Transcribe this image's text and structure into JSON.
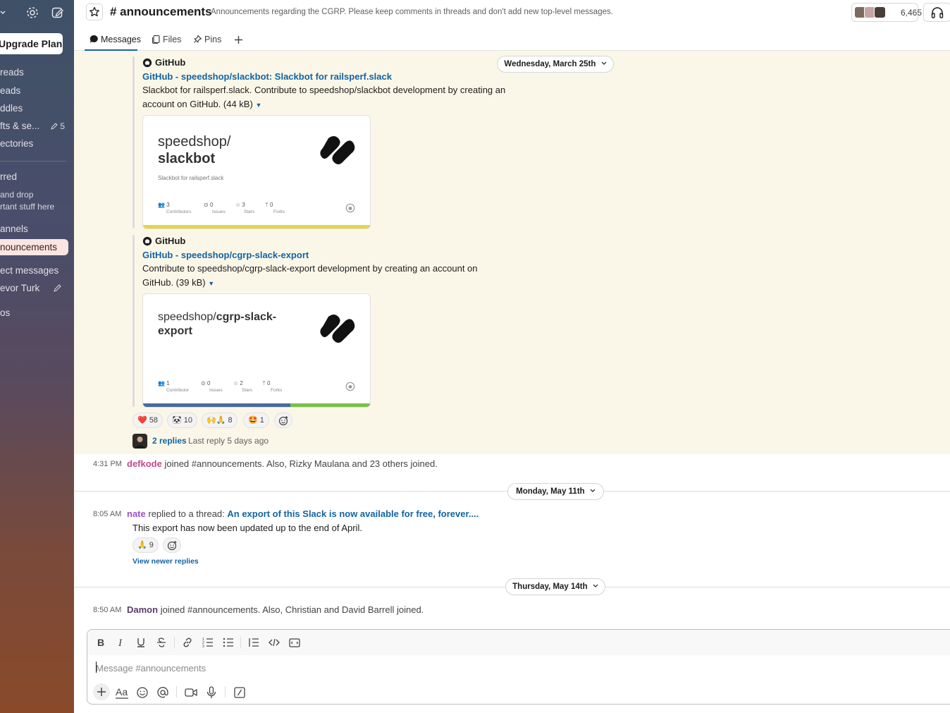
{
  "sidebar": {
    "upgrade_label": "Upgrade Plan",
    "items": [
      {
        "label": "Threads",
        "visible": "reads"
      },
      {
        "label": "Threads",
        "visible": "eads"
      },
      {
        "label": "Huddles",
        "visible": "ddles"
      },
      {
        "label": "Drafts & sent",
        "visible": "fts & se..."
      },
      {
        "label": "Directories",
        "visible": "ectories"
      }
    ],
    "drafts_count": "5",
    "starred_label": "rred",
    "starred_hint_1": "and drop",
    "starred_hint_2": "rtant stuff here",
    "channels_label": "annels",
    "active_channel": "nouncements",
    "dm_label": "ect messages",
    "dm_user": "evor Turk",
    "apps_label": "os"
  },
  "header": {
    "channel_name": "# announcements",
    "description": "Announcements regarding the CGRP. Please keep comments in threads and don't add new top-level messages.",
    "member_count": "6,465",
    "tabs": [
      {
        "label": "Messages",
        "icon": "message-icon"
      },
      {
        "label": "Files",
        "icon": "files-icon"
      },
      {
        "label": "Pins",
        "icon": "pin-icon"
      }
    ]
  },
  "feed": {
    "date_1": "Wednesday, March 25th",
    "attachments": [
      {
        "source": "GitHub",
        "title": "GitHub - speedshop/slackbot: Slackbot for railsperf.slack",
        "description": "Slackbot for railsperf.slack. Contribute to speedshop/slackbot development by creating an account on GitHub. (44 kB)",
        "card_title_1": "speedshop/",
        "card_title_2": "slackbot",
        "card_subtitle": "Slackbot for railsperf.slack",
        "stats": [
          {
            "value": "3",
            "label": "Contributors"
          },
          {
            "value": "0",
            "label": "Issues"
          },
          {
            "value": "3",
            "label": "Stars"
          },
          {
            "value": "0",
            "label": "Forks"
          }
        ]
      },
      {
        "source": "GitHub",
        "title": "GitHub - speedshop/cgrp-slack-export",
        "description": "Contribute to speedshop/cgrp-slack-export development by creating an account on GitHub. (39 kB)",
        "card_title_1": "speedshop/",
        "card_title_bold": "cgrp-slack-",
        "card_title_2": "export",
        "stats": [
          {
            "value": "1",
            "label": "Contributor"
          },
          {
            "value": "0",
            "label": "Issues"
          },
          {
            "value": "2",
            "label": "Stars"
          },
          {
            "value": "0",
            "label": "Forks"
          }
        ]
      }
    ],
    "reactions": [
      {
        "emoji": "❤️",
        "count": "58"
      },
      {
        "emoji": "🐼",
        "count": "10"
      },
      {
        "emoji": "🙌🙏",
        "count": "8"
      },
      {
        "emoji": "🤩",
        "count": "1"
      }
    ],
    "replies_label": "2 replies",
    "last_reply": "Last reply 5 days ago",
    "join_1": {
      "time": "4:31 PM",
      "user": "defkode",
      "text": "joined #announcements. Also, Rizky Maulana and 23 others joined."
    },
    "date_2": "Monday, May 11th",
    "reply_msg": {
      "time": "8:05 AM",
      "user": "nate",
      "prefix": "replied to a thread:",
      "thread_link": "An export of this Slack is now available for free, forever....",
      "body": "This export has now been updated up to the end of April.",
      "reaction_emoji": "🙏",
      "reaction_count": "9",
      "view_newer": "View newer replies"
    },
    "date_3": "Thursday, May 14th",
    "join_2": {
      "time": "8:50 AM",
      "user": "Damon",
      "text": "joined #announcements. Also, Christian and David Barrell joined."
    }
  },
  "composer": {
    "placeholder": "Message #announcements"
  },
  "colors": {
    "link": "#1264a3",
    "highlight": "#fbf7e8",
    "defkode_user": "#c24a8e",
    "nate_user": "#9b52c4",
    "damon_user": "#5b3a6b"
  }
}
